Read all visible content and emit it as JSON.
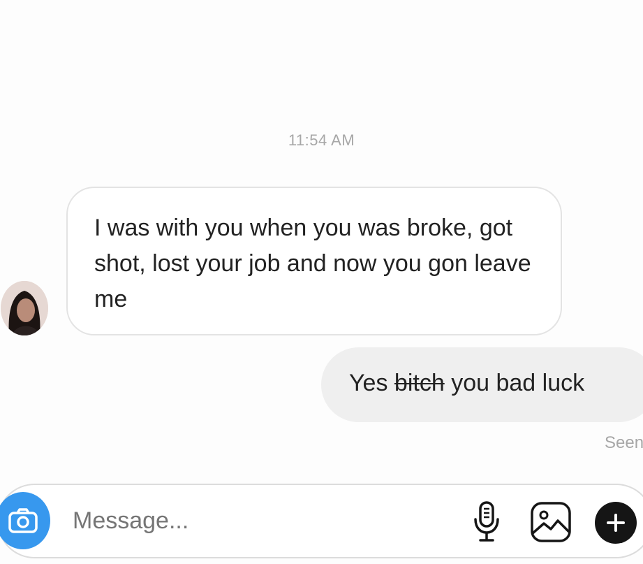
{
  "chat": {
    "timestamp": "11:54 AM",
    "incoming_message": "I was with you when you was broke, got shot, lost your job and now you gon leave me",
    "outgoing_message": {
      "before": "Yes",
      "struck": "bitch",
      "after": "you bad luck"
    },
    "seen_label": "Seen"
  },
  "composer": {
    "placeholder": "Message...",
    "icons": [
      "camera-icon",
      "microphone-icon",
      "gallery-icon",
      "plus-icon"
    ],
    "accent": "#3798ee"
  }
}
